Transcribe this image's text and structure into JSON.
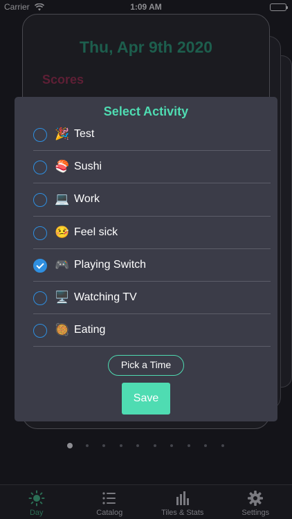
{
  "status_bar": {
    "carrier": "Carrier",
    "time": "1:09 AM"
  },
  "day_card": {
    "title": "Thu, Apr 9th 2020",
    "scores_label": "Scores"
  },
  "modal": {
    "title": "Select Activity",
    "activities": [
      {
        "emoji": "🎉",
        "label": "Test",
        "selected": false
      },
      {
        "emoji": "🍣",
        "label": "Sushi",
        "selected": false
      },
      {
        "emoji": "💻",
        "label": "Work",
        "selected": false
      },
      {
        "emoji": "🤒",
        "label": "Feel sick",
        "selected": false
      },
      {
        "emoji": "🎮",
        "label": "Playing Switch",
        "selected": true
      },
      {
        "emoji": "🖥️",
        "label": "Watching TV",
        "selected": false
      },
      {
        "emoji": "🥘",
        "label": "Eating",
        "selected": false
      }
    ],
    "pick_time_label": "Pick a Time",
    "save_label": "Save"
  },
  "pager": {
    "page_count": 10,
    "current_page": 1
  },
  "tab_bar": {
    "tabs": [
      {
        "label": "Day",
        "icon": "sun-icon",
        "active": true
      },
      {
        "label": "Catalog",
        "icon": "list-icon",
        "active": false
      },
      {
        "label": "Tiles & Stats",
        "icon": "bar-chart-icon",
        "active": false
      },
      {
        "label": "Settings",
        "icon": "gear-icon",
        "active": false
      }
    ]
  },
  "colors": {
    "accent": "#4fdcb2",
    "radio": "#2f8fe0",
    "modal_bg": "#3b3c48",
    "background": "#141419",
    "active_tab": "#2b6e55"
  }
}
